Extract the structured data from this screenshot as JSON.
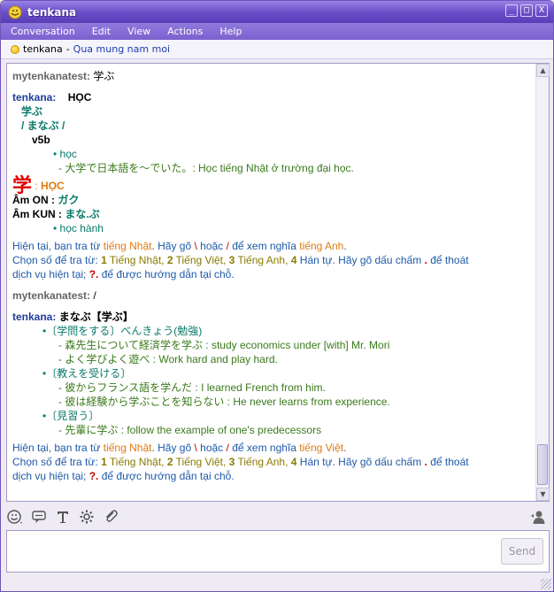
{
  "window": {
    "title": "tenkana",
    "controls": {
      "minimize": "_",
      "maximize": "□",
      "close": "X"
    }
  },
  "menu": [
    "Conversation",
    "Edit",
    "View",
    "Actions",
    "Help"
  ],
  "status": {
    "name": "tenkana",
    "separator": "-",
    "message": "Qua mung nam moi"
  },
  "conversation": {
    "msg1": {
      "sender": "mytenkanatest:",
      "text": "学ぶ"
    },
    "msg2": {
      "sender": "tenkana:",
      "headword": "HỌC",
      "kanji_word": "学ぶ",
      "reading": "/ まなぶ /",
      "verb_class": "v5b",
      "bullet_meaning": "• học",
      "example": "- 大学で日本語を～でいた。: Học tiếng Nhật ở trường đại học.",
      "kanji": "学",
      "kanji_sep": ":",
      "kanji_reading": "HỌC",
      "on_label": "Âm ON :",
      "on_value": "ガク",
      "kun_label": "Âm KUN :",
      "kun_value": "まな.ぶ",
      "bullet_kun": "• học hành",
      "help1": {
        "a": "Hiện tại, bạn tra từ ",
        "b": "tiếng Nhật",
        "c": ". Hãy gõ ",
        "d": "\\",
        "e": " hoặc ",
        "f": "/",
        "g": " để xem nghĩa ",
        "h": "tiếng Anh",
        "i": "."
      },
      "help2": {
        "a": "Chọn số để tra từ: ",
        "n1": "1",
        "t1": " Tiếng Nhật, ",
        "n2": "2",
        "t2": " Tiếng Việt, ",
        "n3": "3",
        "t3": " Tiếng Anh, ",
        "n4": "4",
        "t4": " Hán tự. Hãy gõ dấu chấm ",
        "dot": ".",
        "t5": " để thoát"
      },
      "help3": {
        "a": "dịch vụ hiện tại; ",
        "q": "?.",
        "b": " để được hướng dẫn tại chỗ."
      }
    },
    "msg3": {
      "sender": "mytenkanatest:",
      "text": "/"
    },
    "msg4": {
      "sender": "tenkana:",
      "headword": "まなぶ【学ぶ】",
      "s1": "•〔学問をする〕べんきょう(勉強)",
      "s1e1": "- 森先生について経済学を学ぶ : study economics under [with] Mr. Mori",
      "s1e2": "- よく学びよく遊べ : Work hard and play hard.",
      "s2": "•〔教えを受ける〕",
      "s2e1": "- 彼からフランス語を学んだ : I learned French from him.",
      "s2e2": "- 彼は経験から学ぶことを知らない : He never learns from experience.",
      "s3": "•〔見習う〕",
      "s3e1": "- 先輩に学ぶ : follow the example of one's predecessors",
      "help1": {
        "a": "Hiện tại, bạn tra từ ",
        "b": "tiếng Nhật",
        "c": ". Hãy gõ ",
        "d": "\\",
        "e": " hoặc ",
        "f": "/",
        "g": " để xem nghĩa ",
        "h": "tiếng Việt",
        "i": "."
      }
    }
  },
  "input": {
    "send_label": "Send"
  },
  "colors": {
    "accent": "#6a4fc8",
    "link_blue": "#1e5aa8",
    "teal": "#0a7a6a",
    "green": "#3a7a1a",
    "orange": "#e07a10",
    "red": "#cc0000"
  }
}
